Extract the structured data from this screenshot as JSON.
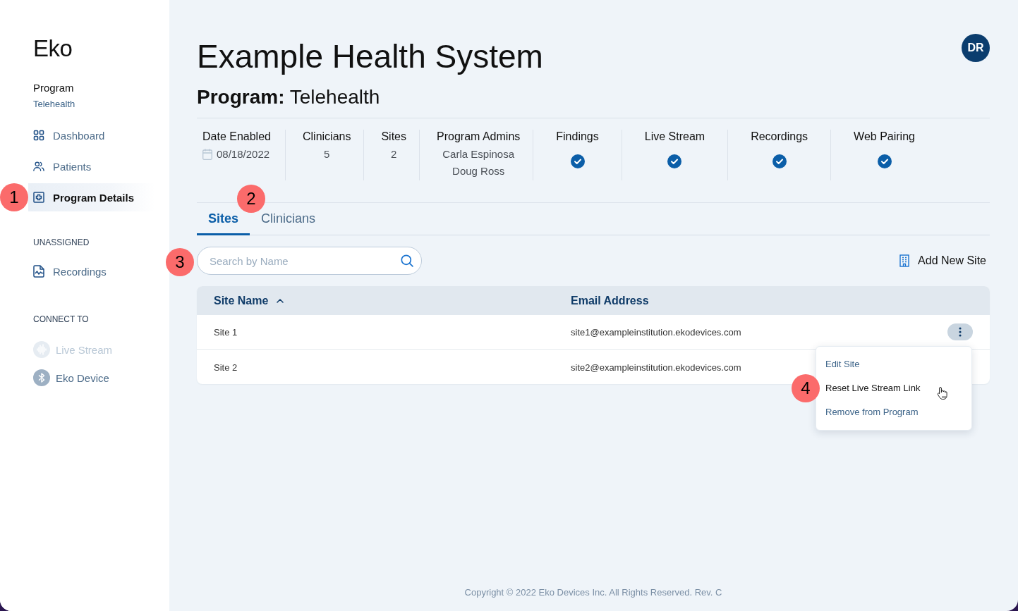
{
  "sidebar": {
    "logo": "Eko",
    "program_label": "Program",
    "program_name": "Telehealth",
    "nav": [
      {
        "label": "Dashboard",
        "selected": false
      },
      {
        "label": "Patients",
        "selected": false
      },
      {
        "label": "Program Details",
        "selected": true,
        "callout": "1"
      }
    ],
    "unassigned": {
      "heading": "UNASSIGNED",
      "items": [
        {
          "label": "Recordings",
          "selected": false
        }
      ]
    },
    "connect_to": {
      "heading": "CONNECT TO",
      "items": [
        {
          "label": "Live Stream",
          "disabled": true
        },
        {
          "label": "Eko Device",
          "disabled": false
        }
      ]
    }
  },
  "header": {
    "title": "Example Health System",
    "subtitle": "**Program:** Telehealth",
    "avatar": "DR"
  },
  "stats": [
    {
      "kind": "date",
      "label": "Date Enabled",
      "values": [
        "08/18/2022"
      ]
    },
    {
      "kind": "text",
      "label": "Clinicians",
      "values": [
        "5"
      ]
    },
    {
      "kind": "text",
      "label": "Sites",
      "values": [
        "2"
      ]
    },
    {
      "kind": "text",
      "label": "Program Admins",
      "values": [
        "Carla Espinosa",
        "Doug Ross"
      ]
    },
    {
      "kind": "check",
      "label": "Findings",
      "checked": true
    },
    {
      "kind": "check",
      "label": "Live Stream",
      "checked": true
    },
    {
      "kind": "check",
      "label": "Recordings",
      "checked": true
    },
    {
      "kind": "check",
      "label": "Web Pairing",
      "checked": true
    }
  ],
  "tabs": [
    {
      "label": "Sites",
      "selected": true
    },
    {
      "label": "Clinicians",
      "selected": false,
      "callout": "2"
    }
  ],
  "search": {
    "placeholder": "Search by Name",
    "callout": "3"
  },
  "add_button": {
    "label": "Add New Site"
  },
  "table": {
    "columns": [
      {
        "label": "Site Name",
        "sorted": true,
        "descending": false
      },
      {
        "label": "Email Address",
        "sorted": false
      }
    ],
    "rows": [
      {
        "cells": [
          "Site 1",
          "site1@exampleinstitution.ekodevices.com"
        ],
        "menu_open": true,
        "menu": [
          {
            "label": "Edit Site",
            "highlighted": false
          },
          {
            "label": "Reset Live Stream Link",
            "highlighted": true,
            "callout": "4"
          },
          {
            "label": "Remove from Program",
            "highlighted": false
          }
        ]
      },
      {
        "cells": [
          "Site 2",
          "site2@exampleinstitution.ekodevices.com"
        ],
        "menu_open": false
      }
    ]
  },
  "footer": {
    "text": "Copyright © 2022 Eko Devices Inc. All Rights Reserved. Rev. C"
  }
}
